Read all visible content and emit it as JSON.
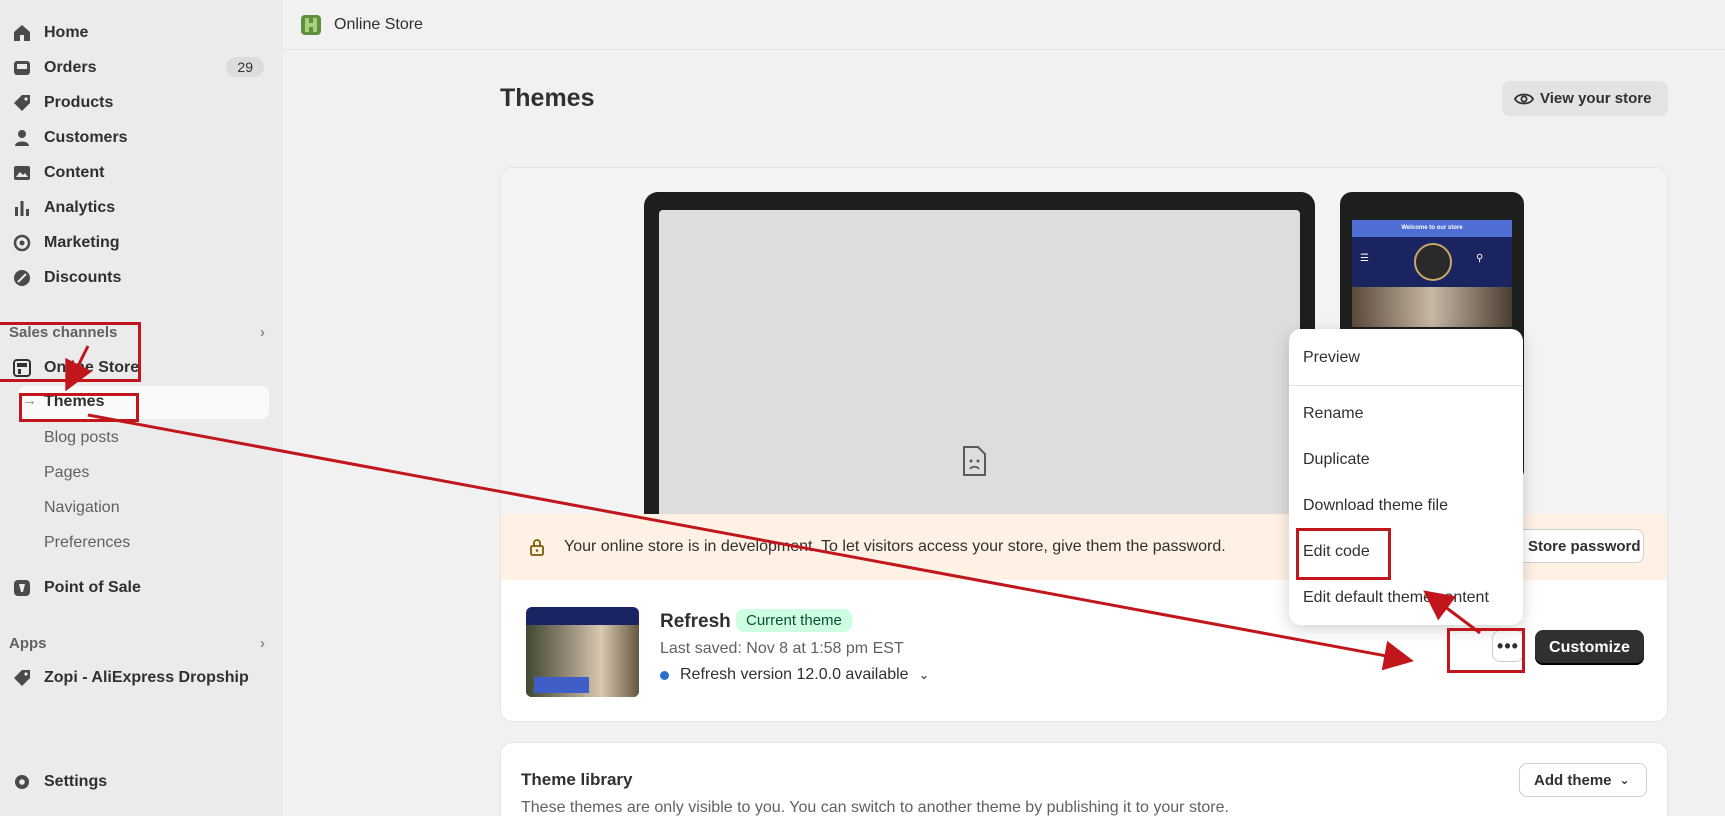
{
  "sidebar": {
    "items": [
      {
        "label": "Home",
        "icon": "home-icon"
      },
      {
        "label": "Orders",
        "icon": "orders-icon",
        "badge": "29"
      },
      {
        "label": "Products",
        "icon": "tag-icon"
      },
      {
        "label": "Customers",
        "icon": "person-icon"
      },
      {
        "label": "Content",
        "icon": "image-icon"
      },
      {
        "label": "Analytics",
        "icon": "bar-chart-icon"
      },
      {
        "label": "Marketing",
        "icon": "target-icon"
      },
      {
        "label": "Discounts",
        "icon": "discount-icon"
      }
    ],
    "sales_channels_label": "Sales channels",
    "online_store_label": "Online Store",
    "online_store_sub": [
      "Themes",
      "Blog posts",
      "Pages",
      "Navigation",
      "Preferences"
    ],
    "pos_label": "Point of Sale",
    "apps_label": "Apps",
    "app_item_label": "Zopi - AliExpress Dropship",
    "settings_label": "Settings"
  },
  "topbar": {
    "title": "Online Store"
  },
  "page": {
    "title": "Themes",
    "view_store_label": "View your store"
  },
  "preview": {
    "phone_banner": "Welcome to our store"
  },
  "banner": {
    "text": "Your online store is in development. To let visitors access your store, give them the password.",
    "button_label": "Store password"
  },
  "current_theme": {
    "name": "Refresh",
    "badge": "Current theme",
    "last_saved": "Last saved: Nov 8 at 1:58 pm EST",
    "version": "Refresh version 12.0.0 available",
    "more_label": "•••",
    "customize_label": "Customize"
  },
  "menu": {
    "items": [
      "Preview",
      "Rename",
      "Duplicate",
      "Download theme file",
      "Edit code",
      "Edit default theme content"
    ]
  },
  "library": {
    "title": "Theme library",
    "description": "These themes are only visible to you. You can switch to another theme by publishing it to your store.",
    "add_theme_label": "Add theme"
  },
  "colors": {
    "annotation": "#c0161c",
    "accent_dark": "#303030",
    "badge_green_bg": "#cdfee1",
    "banner_bg": "#fff1e3"
  }
}
